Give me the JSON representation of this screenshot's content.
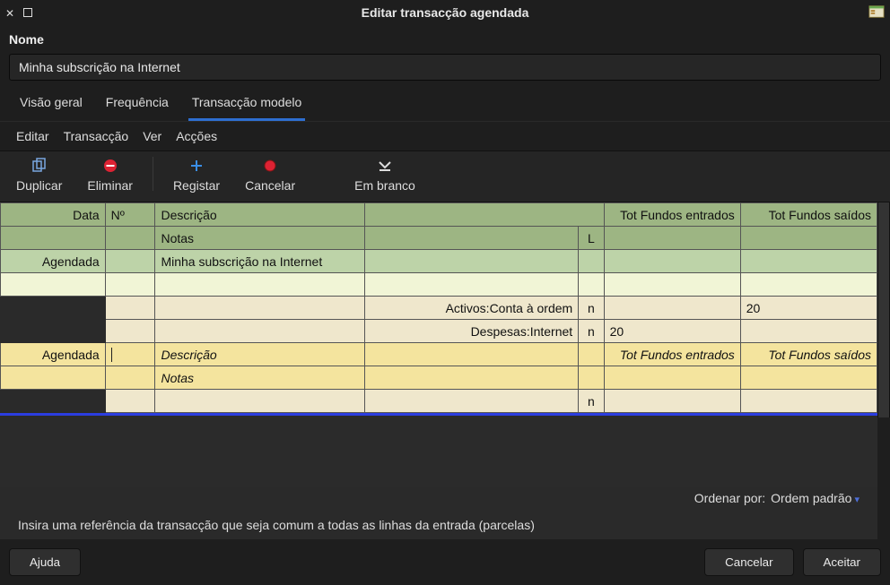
{
  "window": {
    "title": "Editar transacção agendada"
  },
  "section_label": "Nome",
  "name_value": "Minha subscrição na Internet",
  "tabs": [
    {
      "label": "Visão geral"
    },
    {
      "label": "Frequência"
    },
    {
      "label": "Transacção modelo"
    }
  ],
  "menubar": {
    "edit": "Editar",
    "transaction": "Transacção",
    "view": "Ver",
    "actions": "Acções"
  },
  "toolbar": {
    "duplicate": "Duplicar",
    "delete": "Eliminar",
    "enter": "Registar",
    "cancel": "Cancelar",
    "blank": "Em branco"
  },
  "headers": {
    "date": "Data",
    "num": "Nº",
    "desc": "Descrição",
    "notes": "Notas",
    "rec": "L",
    "in": "Tot Fundos entrados",
    "out": "Tot Fundos saídos"
  },
  "rows": {
    "scheduled_label": "Agendada",
    "tx_desc": "Minha subscrição na Internet",
    "split1_account": "Activos:Conta à ordem",
    "split1_rec": "n",
    "split1_out": "20",
    "split2_account": "Despesas:Internet",
    "split2_rec": "n",
    "split2_in": "20",
    "edit_date": "Agendada",
    "edit_num": "",
    "edit_desc_ph": "Descrição",
    "edit_in_ph": "Tot Fundos entrados",
    "edit_out_ph": "Tot Fundos saídos",
    "edit_notes_ph": "Notas",
    "blank_rec": "n"
  },
  "sort": {
    "label": "Ordenar por:",
    "value": "Ordem padrão"
  },
  "hint": "Insira uma referência da transacção que seja comum a todas as linhas da entrada (parcelas)",
  "buttons": {
    "help": "Ajuda",
    "cancel": "Cancelar",
    "accept": "Aceitar"
  }
}
